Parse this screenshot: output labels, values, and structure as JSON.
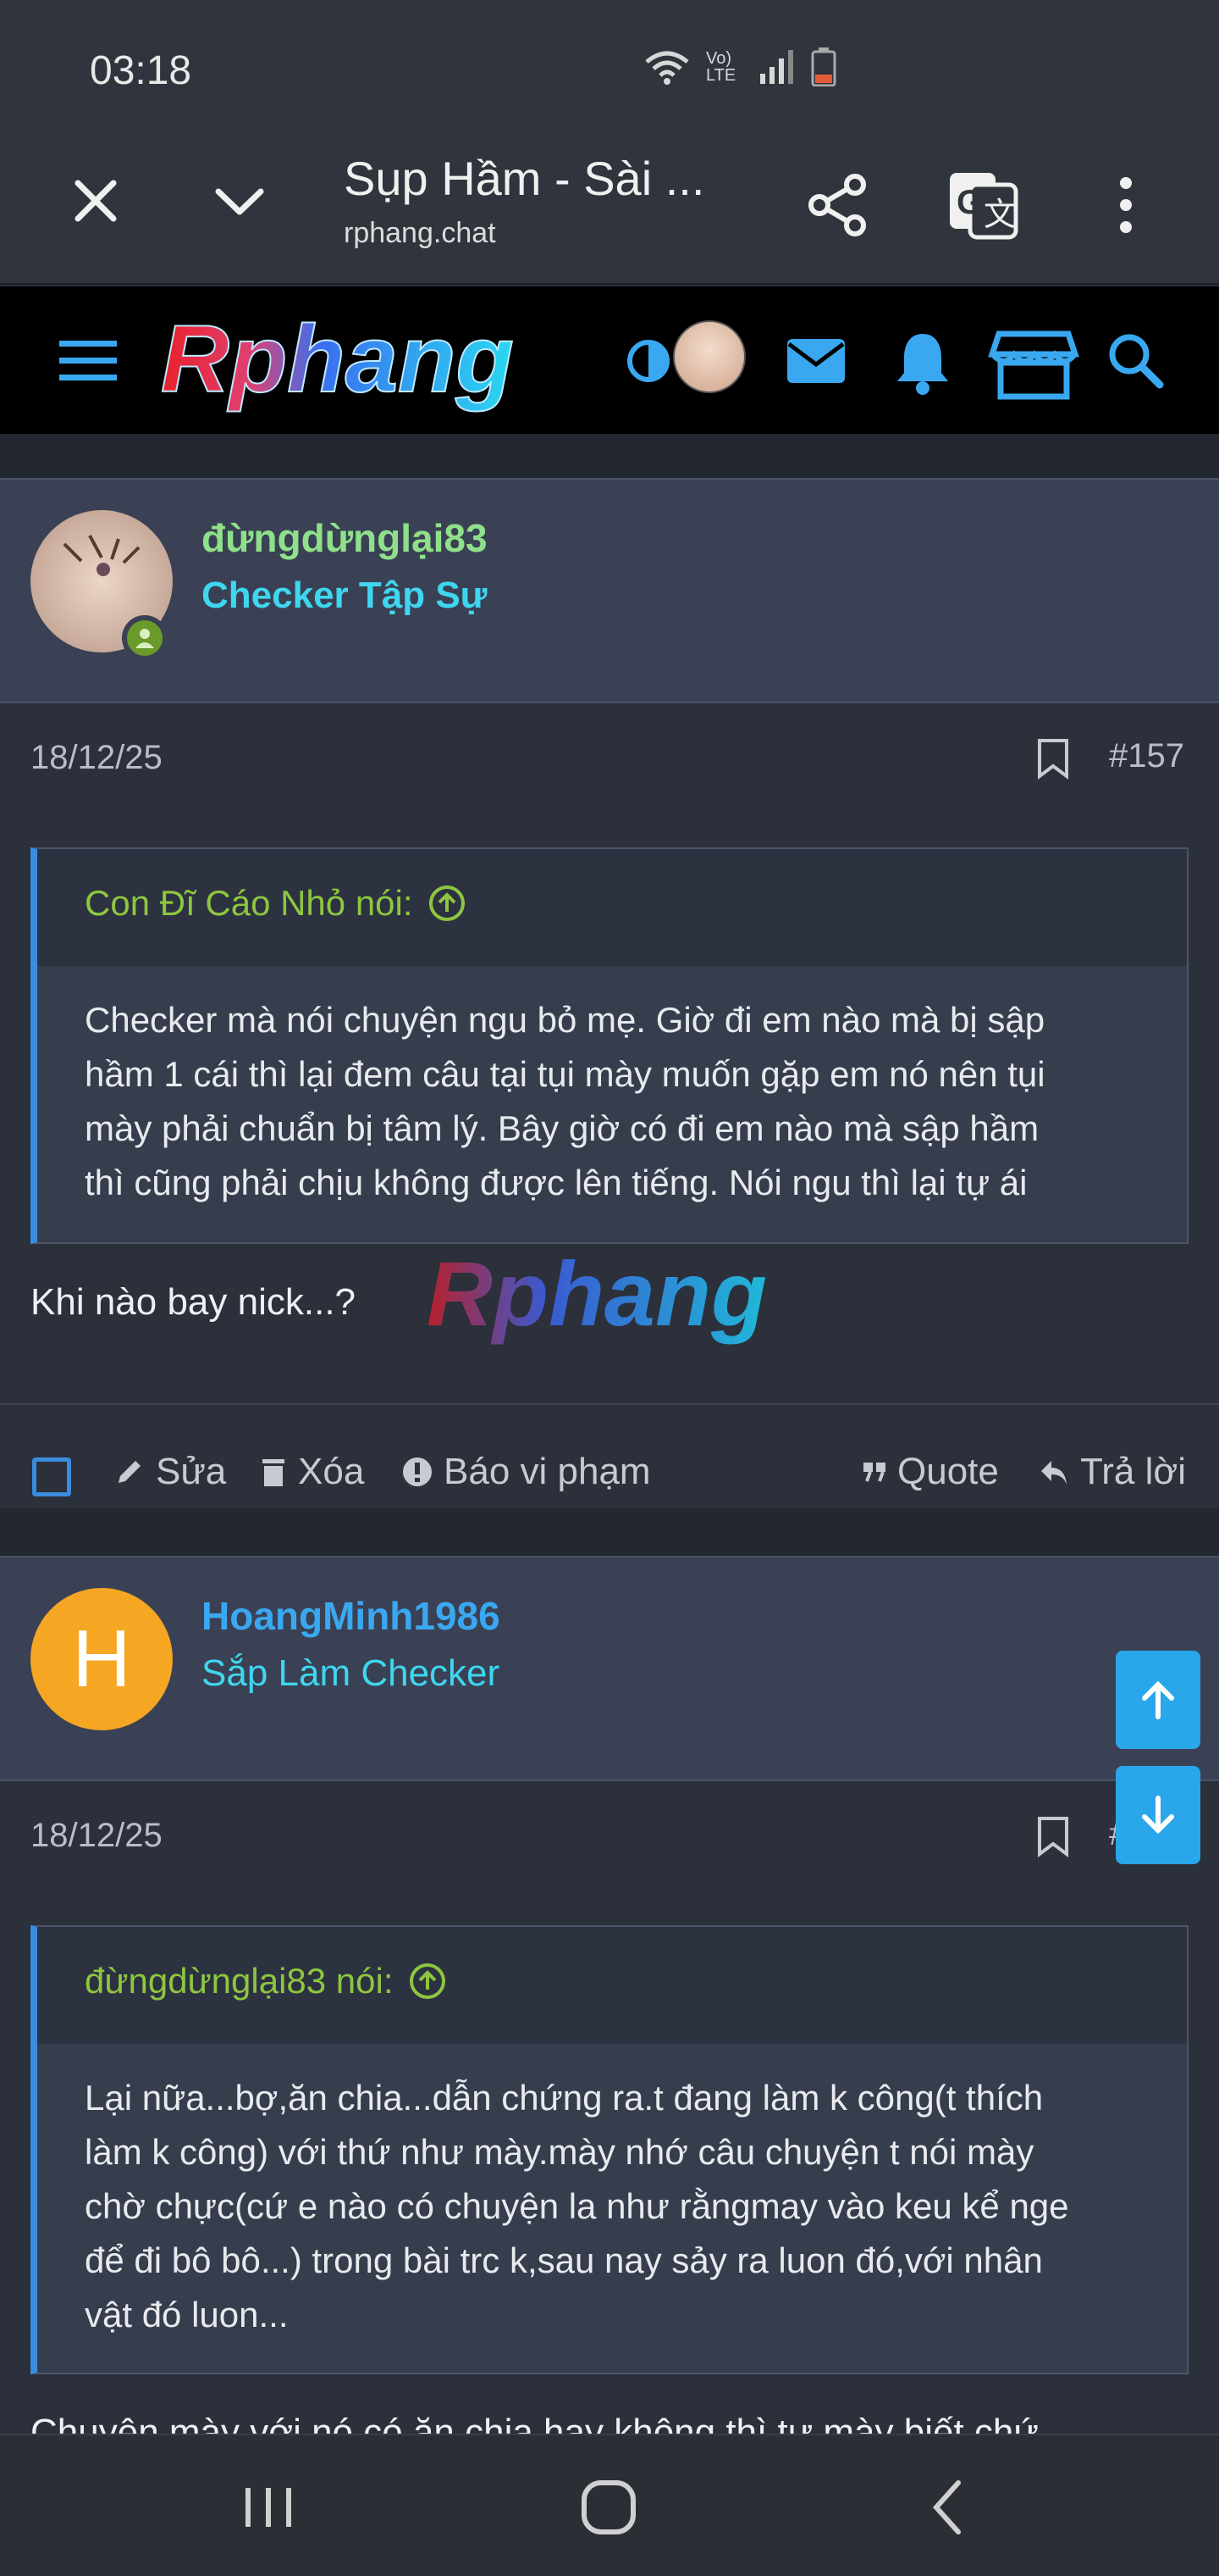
{
  "status_bar": {
    "time": "03:18",
    "icons": [
      "wifi-icon",
      "volte-icon",
      "signal-icon",
      "battery-icon"
    ],
    "volte_text": "Vo) LTE"
  },
  "browser": {
    "title": "Sụp Hầm - Sài ...",
    "url": "rphang.chat",
    "icons": [
      "close-icon",
      "chevron-down-icon",
      "share-icon",
      "translate-icon",
      "more-vert-icon"
    ]
  },
  "site_nav": {
    "logo": "Rphang",
    "icons": [
      "menu-icon",
      "theme-toggle-icon",
      "avatar",
      "mail-icon",
      "bell-icon",
      "store-icon",
      "search-icon"
    ]
  },
  "colors": {
    "accent": "#3a8dde",
    "username_green": "#8fe08a",
    "username_blue": "#3aa8f0",
    "title_cyan": "#3fd6f0",
    "quote_green": "#8ec63f"
  },
  "posts": [
    {
      "username": "đừngdừnglại83",
      "user_title": "Checker Tập Sự",
      "date": "18/12/25",
      "post_number": "#157",
      "quote_author": "Con Đĩ Cáo Nhỏ nói:",
      "quote_lines": [
        "Checker mà nói chuyện ngu bỏ mẹ. Giờ đi em nào mà bị sập",
        "hầm 1 cái thì lại đem câu tại tụi mày muốn gặp em nó nên tụi",
        "mày phải chuẩn bị tâm lý. Bây giờ có đi em nào mà sập hầm",
        "thì cũng phải chịu không được lên tiếng. Nói ngu thì lại tự ái"
      ],
      "text": "Khi nào bay nick...?",
      "watermark": "Rphang",
      "actions": {
        "edit": "Sửa",
        "delete": "Xóa",
        "report": "Báo vi phạm",
        "quote": "Quote",
        "reply": "Trả lời"
      }
    },
    {
      "username": "HoangMinh1986",
      "avatar_letter": "H",
      "user_title": "Sắp Làm Checker",
      "date": "18/12/25",
      "post_number": "#",
      "quote_author": "đừngdừnglại83 nói:",
      "quote_lines": [
        "Lại nữa...bợ,ăn chia...dẫn chứng ra.t đang làm k công(t thích",
        "làm k công) với thứ như mày.mày nhớ câu chuyện t nói mày",
        "chờ chực(cứ e nào có chuyện la như rằngmay vào keu kể nge",
        "để đi bô bô...) trong bài trc k,sau nay sảy ra luon đó,với nhân",
        "vật đó luon..."
      ],
      "text_partial": "Chuyện mày với nó có ăn chia hay không thì tự mày biết chứ"
    }
  ],
  "system_nav": {
    "icons": [
      "recent-apps-icon",
      "home-icon",
      "back-icon"
    ]
  }
}
